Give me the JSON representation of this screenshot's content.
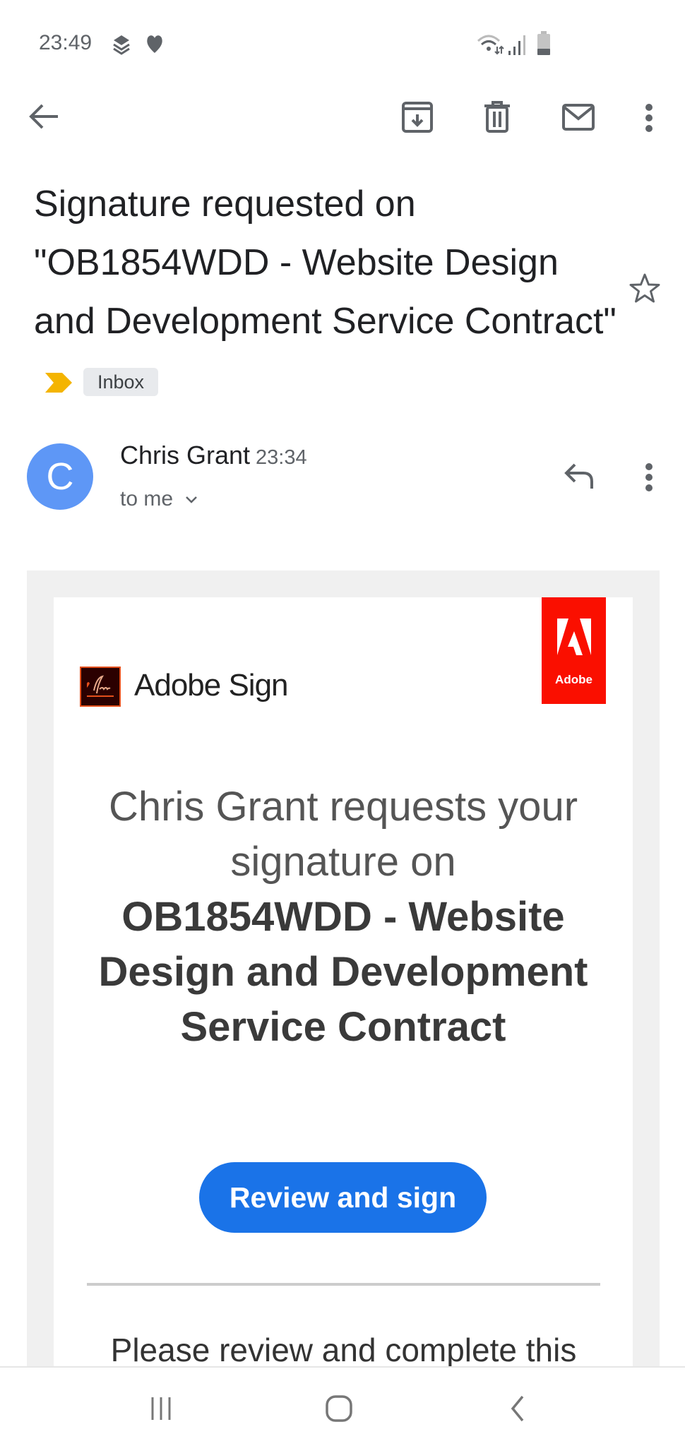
{
  "status_bar": {
    "time": "23:49",
    "icons": [
      "layers-icon",
      "heart-icon",
      "wifi-icon",
      "signal-icon",
      "battery-icon"
    ]
  },
  "toolbar": {
    "icons": [
      "back-arrow-icon",
      "archive-icon",
      "trash-icon",
      "mark-unread-icon",
      "more-vert-icon"
    ]
  },
  "email": {
    "subject": "Signature requested on \"OB1854WDD - Website Design and Development Service Contract\"",
    "label": "Inbox",
    "sender": {
      "initial": "C",
      "name": "Chris Grant",
      "time": "23:34",
      "recipient": "to me"
    }
  },
  "body": {
    "brand": "Adobe Sign",
    "adobe_logo_text": "Adobe",
    "heading_light": "Chris Grant requests your signature on",
    "heading_bold": "OB1854WDD - Website Design and Development Service Contract",
    "cta": "Review and sign",
    "text": "Please review and complete this"
  },
  "colors": {
    "accent": "#1a73e8",
    "avatar": "#5e97f6",
    "adobe_red": "#fa0f00",
    "important": "#f4b400"
  }
}
